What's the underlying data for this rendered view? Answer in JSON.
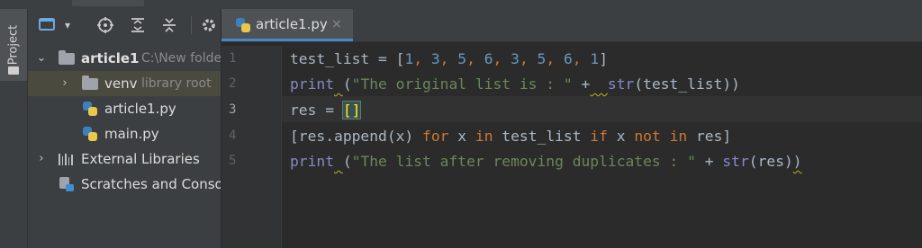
{
  "side_stripe": {
    "label": "Project"
  },
  "project_tree": {
    "root": {
      "name": "article1",
      "path_hint": "C:\\New folde"
    },
    "items": [
      {
        "name": "venv",
        "hint": "library root",
        "type": "folder",
        "selected": true
      },
      {
        "name": "article1.py",
        "type": "python-file"
      },
      {
        "name": "main.py",
        "type": "python-file"
      }
    ],
    "external_libraries": "External Libraries",
    "scratches": "Scratches and Consol"
  },
  "toolbar": {
    "view_icon": "window-icon",
    "view_chevron": "▾",
    "locate_icon": "crosshair-icon",
    "expand_icon": "expand-all-icon",
    "collapse_icon": "collapse-all-icon",
    "settings_icon": "gear-icon"
  },
  "editor": {
    "tab": {
      "name": "article1.py",
      "close": "×"
    },
    "line_numbers": [
      "1",
      "2",
      "3",
      "4",
      "5"
    ],
    "current_line": 3,
    "lines": [
      [
        [
          "test_list = [",
          ""
        ],
        [
          "1",
          "num"
        ],
        [
          ", ",
          "kw"
        ],
        [
          "3",
          "num"
        ],
        [
          ", ",
          "kw"
        ],
        [
          "5",
          "num"
        ],
        [
          ", ",
          "kw"
        ],
        [
          "6",
          "num"
        ],
        [
          ", ",
          "kw"
        ],
        [
          "3",
          "num"
        ],
        [
          ", ",
          "kw"
        ],
        [
          "5",
          "num"
        ],
        [
          ", ",
          "kw"
        ],
        [
          "6",
          "num"
        ],
        [
          ", ",
          "kw"
        ],
        [
          "1",
          "num"
        ],
        [
          "]",
          ""
        ]
      ],
      [
        [
          "print",
          "fn"
        ],
        [
          " ",
          "squig"
        ],
        [
          "(",
          ""
        ],
        [
          "\"The original list is : \"",
          "str"
        ],
        [
          " +",
          ""
        ],
        [
          "  ",
          "squig"
        ],
        [
          "str",
          "fn"
        ],
        [
          "(test_list))",
          ""
        ]
      ],
      [
        [
          "res = ",
          ""
        ],
        [
          "[]",
          "brk"
        ]
      ],
      [
        [
          "[res.append(x) ",
          ""
        ],
        [
          "for",
          "kw"
        ],
        [
          " x ",
          ""
        ],
        [
          "in",
          "kw"
        ],
        [
          " test_list ",
          ""
        ],
        [
          "if",
          "kw"
        ],
        [
          " x ",
          ""
        ],
        [
          "not in",
          "kw"
        ],
        [
          " res]",
          ""
        ]
      ],
      [
        [
          "print",
          "fn"
        ],
        [
          " ",
          "squig"
        ],
        [
          "(",
          ""
        ],
        [
          "\"The list after removing duplicates : \"",
          "str"
        ],
        [
          " + ",
          ""
        ],
        [
          "str",
          "fn"
        ],
        [
          "(res)",
          ""
        ],
        [
          ")",
          "squig"
        ]
      ]
    ]
  },
  "colors": {
    "background": "#2b2b2b",
    "panel": "#3c3f41",
    "keyword": "#cc7832",
    "number": "#6897bb",
    "string": "#6a8759",
    "builtin": "#8888c6",
    "selection": "#4b4a3f"
  }
}
